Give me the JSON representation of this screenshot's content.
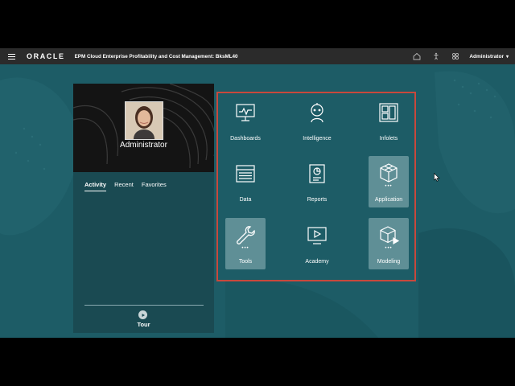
{
  "header": {
    "logo": "ORACLE",
    "app_title": "EPM Cloud Enterprise Profitability and Cost Management: BksML40",
    "user_menu": "Administrator",
    "icons": [
      "home-icon",
      "accessibility-icon",
      "navigator-icon"
    ]
  },
  "left_panel": {
    "user_name": "Administrator",
    "tabs": [
      {
        "label": "Activity",
        "active": true
      },
      {
        "label": "Recent",
        "active": false
      },
      {
        "label": "Favorites",
        "active": false
      }
    ],
    "tour_label": "Tour"
  },
  "grid": {
    "tiles": [
      {
        "label": "Dashboards",
        "icon": "dashboard-monitor-icon",
        "highlighted": false,
        "has_dots": false
      },
      {
        "label": "Intelligence",
        "icon": "intelligence-robot-icon",
        "highlighted": false,
        "has_dots": false
      },
      {
        "label": "Infolets",
        "icon": "infolets-layout-icon",
        "highlighted": false,
        "has_dots": false
      },
      {
        "label": "Data",
        "icon": "data-table-icon",
        "highlighted": false,
        "has_dots": false
      },
      {
        "label": "Reports",
        "icon": "reports-document-icon",
        "highlighted": false,
        "has_dots": false
      },
      {
        "label": "Application",
        "icon": "application-cubes-icon",
        "highlighted": true,
        "has_dots": true
      },
      {
        "label": "Tools",
        "icon": "tools-wrench-icon",
        "highlighted": true,
        "has_dots": true
      },
      {
        "label": "Academy",
        "icon": "academy-play-icon",
        "highlighted": false,
        "has_dots": false
      },
      {
        "label": "Modeling",
        "icon": "modeling-cube-play-icon",
        "highlighted": true,
        "has_dots": true
      }
    ],
    "dots": "•••"
  },
  "colors": {
    "background": "#1d5c66",
    "topbar": "#2b2b2b",
    "highlight_frame": "#c9483c",
    "panel_dark": "#141414"
  }
}
